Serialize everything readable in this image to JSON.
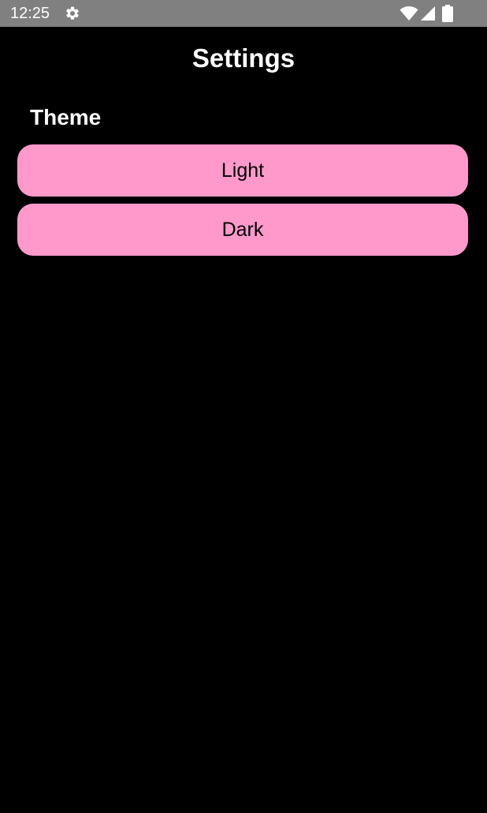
{
  "status_bar": {
    "time": "12:25",
    "icons": [
      "gear-icon",
      "wifi-icon",
      "signal-icon",
      "battery-icon"
    ],
    "background_color": "#808080"
  },
  "header": {
    "title": "Settings"
  },
  "theme_section": {
    "label": "Theme",
    "options": [
      {
        "label": "Light"
      },
      {
        "label": "Dark"
      }
    ],
    "button_color": "#ff99cc"
  },
  "colors": {
    "background": "#000000",
    "text": "#ffffff"
  }
}
